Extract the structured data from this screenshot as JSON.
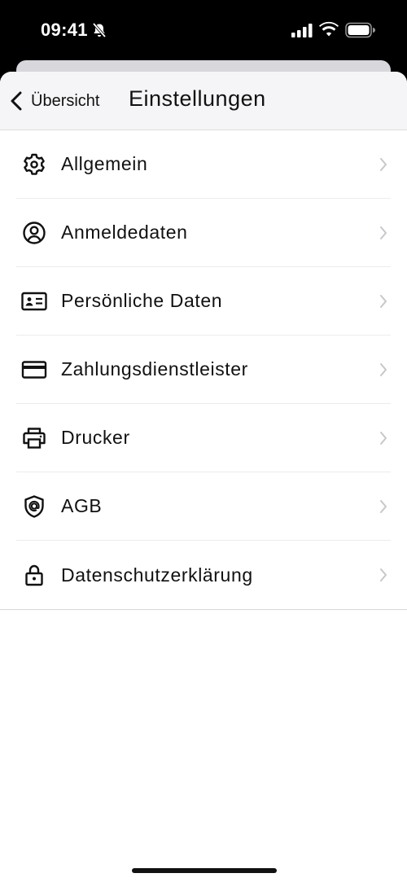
{
  "status_bar": {
    "time": "09:41"
  },
  "nav": {
    "back_label": "Übersicht",
    "title": "Einstellungen"
  },
  "menu": {
    "items": [
      {
        "label": "Allgemein",
        "icon": "gear-icon"
      },
      {
        "label": "Anmeldedaten",
        "icon": "user-circle-icon"
      },
      {
        "label": "Persönliche Daten",
        "icon": "id-card-icon"
      },
      {
        "label": "Zahlungsdienstleister",
        "icon": "credit-card-icon"
      },
      {
        "label": "Drucker",
        "icon": "printer-icon"
      },
      {
        "label": "AGB",
        "icon": "shield-icon"
      },
      {
        "label": "Datenschutzerklärung",
        "icon": "lock-icon"
      }
    ]
  },
  "colors": {
    "background": "#ffffff",
    "nav_background": "#f5f5f7",
    "text": "#111111",
    "chevron": "#c7c7cc"
  }
}
